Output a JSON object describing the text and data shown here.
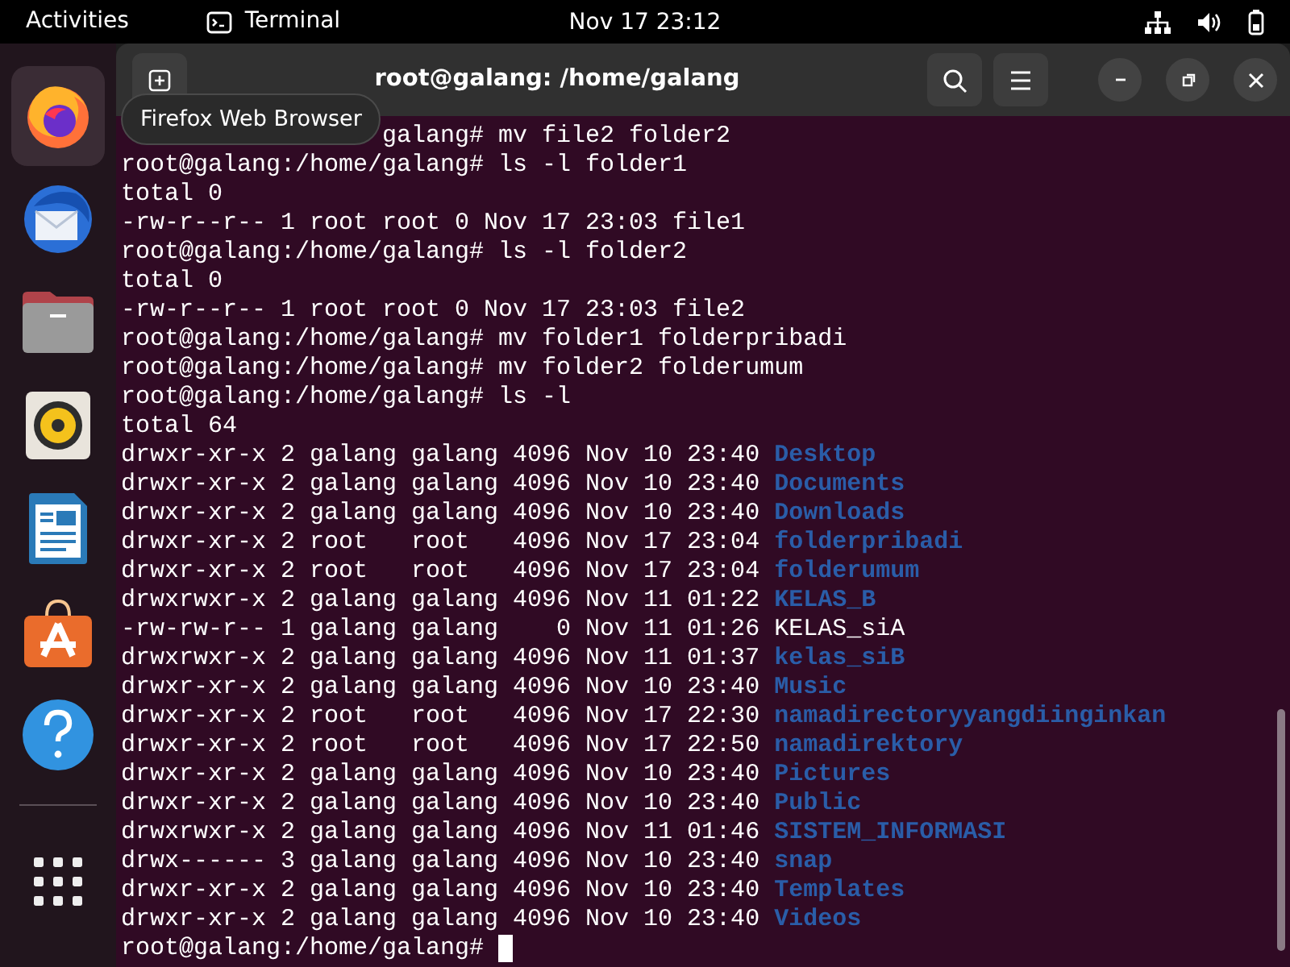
{
  "top_bar": {
    "activities": "Activities",
    "app_name": "Terminal",
    "clock": "Nov 17  23:12"
  },
  "dock": {
    "items": [
      {
        "kind": "browser",
        "selected": true
      },
      {
        "kind": "mail",
        "selected": false
      },
      {
        "kind": "files",
        "selected": false
      },
      {
        "kind": "music",
        "selected": false
      },
      {
        "kind": "writer",
        "selected": false
      },
      {
        "kind": "store",
        "selected": false
      },
      {
        "kind": "help",
        "selected": false
      }
    ],
    "tooltip": "Firefox Web Browser"
  },
  "window": {
    "title": "root@galang: /home/galang"
  },
  "terminal": {
    "lines": [
      {
        "text": "galang# mv file2 folder2",
        "covered": true
      },
      {
        "text": "root@galang:/home/galang# ls -l folder1"
      },
      {
        "text": "total 0"
      },
      {
        "text": "-rw-r--r-- 1 root root 0 Nov 17 23:03 file1"
      },
      {
        "text": "root@galang:/home/galang# ls -l folder2"
      },
      {
        "text": "total 0"
      },
      {
        "text": "-rw-r--r-- 1 root root 0 Nov 17 23:03 file2"
      },
      {
        "text": "root@galang:/home/galang# mv folder1 folderpribadi"
      },
      {
        "text": "root@galang:/home/galang# mv folder2 folderumum"
      },
      {
        "text": "root@galang:/home/galang# ls -l"
      },
      {
        "text": "total 64"
      },
      {
        "text": "drwxr-xr-x 2 galang galang 4096 Nov 10 23:40",
        "name": "Desktop",
        "kind": "dir"
      },
      {
        "text": "drwxr-xr-x 2 galang galang 4096 Nov 10 23:40",
        "name": "Documents",
        "kind": "dir"
      },
      {
        "text": "drwxr-xr-x 2 galang galang 4096 Nov 10 23:40",
        "name": "Downloads",
        "kind": "dir"
      },
      {
        "text": "drwxr-xr-x 2 root   root   4096 Nov 17 23:04",
        "name": "folderpribadi",
        "kind": "dir"
      },
      {
        "text": "drwxr-xr-x 2 root   root   4096 Nov 17 23:04",
        "name": "folderumum",
        "kind": "dir"
      },
      {
        "text": "drwxrwxr-x 2 galang galang 4096 Nov 11 01:22",
        "name": "KELAS_B",
        "kind": "dir"
      },
      {
        "text": "-rw-rw-r-- 1 galang galang    0 Nov 11 01:26",
        "name": "KELAS_siA",
        "kind": "file"
      },
      {
        "text": "drwxrwxr-x 2 galang galang 4096 Nov 11 01:37",
        "name": "kelas_siB",
        "kind": "dir"
      },
      {
        "text": "drwxr-xr-x 2 galang galang 4096 Nov 10 23:40",
        "name": "Music",
        "kind": "dir"
      },
      {
        "text": "drwxr-xr-x 2 root   root   4096 Nov 17 22:30",
        "name": "namadirectoryyangdiinginkan",
        "kind": "dir"
      },
      {
        "text": "drwxr-xr-x 2 root   root   4096 Nov 17 22:50",
        "name": "namadirektory",
        "kind": "dir"
      },
      {
        "text": "drwxr-xr-x 2 galang galang 4096 Nov 10 23:40",
        "name": "Pictures",
        "kind": "dir"
      },
      {
        "text": "drwxr-xr-x 2 galang galang 4096 Nov 10 23:40",
        "name": "Public",
        "kind": "dir"
      },
      {
        "text": "drwxrwxr-x 2 galang galang 4096 Nov 11 01:46",
        "name": "SISTEM_INFORMASI",
        "kind": "dir"
      },
      {
        "text": "drwx------ 3 galang galang 4096 Nov 10 23:40",
        "name": "snap",
        "kind": "dir"
      },
      {
        "text": "drwxr-xr-x 2 galang galang 4096 Nov 10 23:40",
        "name": "Templates",
        "kind": "dir"
      },
      {
        "text": "drwxr-xr-x 2 galang galang 4096 Nov 10 23:40",
        "name": "Videos",
        "kind": "dir"
      },
      {
        "text": "root@galang:/home/galang#",
        "cursor": true
      }
    ]
  }
}
